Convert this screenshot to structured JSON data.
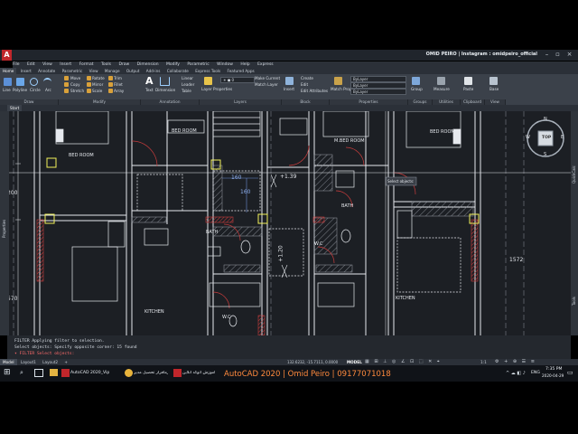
{
  "window": {
    "title": "OMID PEIRO | Instagram : omidpeiro_official",
    "app_logo": "A",
    "controls": [
      "minimize-icon",
      "restore-icon",
      "close-icon"
    ]
  },
  "menubar": [
    "File",
    "Edit",
    "View",
    "Insert",
    "Format",
    "Tools",
    "Draw",
    "Dimension",
    "Modify",
    "Parametric",
    "Window",
    "Help",
    "Express"
  ],
  "ribbon_tabs": [
    "Home",
    "Insert",
    "Annotate",
    "Parametric",
    "View",
    "Manage",
    "Output",
    "Add-ins",
    "Collaborate",
    "Express Tools",
    "Featured Apps"
  ],
  "ribbon": {
    "draw_tools": [
      "Line",
      "Polyline",
      "Circle",
      "Arc"
    ],
    "modify_tools": [
      "Move",
      "Rotate",
      "Trim",
      "Copy",
      "Mirror",
      "Fillet",
      "Stretch",
      "Scale",
      "Array"
    ],
    "annotation_tools": [
      "Text",
      "Dimension",
      "Linear",
      "Leader",
      "Table"
    ],
    "layer_tools": [
      "Layer Properties",
      "Make Current",
      "Match Layer"
    ],
    "block_tools": [
      "Insert",
      "Create",
      "Edit",
      "Edit Attributes"
    ],
    "properties_tools": [
      "Match Properties"
    ],
    "bylayer": [
      "ByLayer",
      "ByLayer",
      "ByLayer"
    ],
    "groups_label": "Group",
    "utilities_tools": [
      "Measure"
    ],
    "clipboard_tools": [
      "Paste"
    ],
    "view_tools": [
      "Base"
    ],
    "panels": [
      "Draw",
      "Modify",
      "Annotation",
      "Layers",
      "Block",
      "Properties",
      "Groups",
      "Utilities",
      "Clipboard",
      "View"
    ]
  },
  "file_tab": "Start",
  "drawing": {
    "room_labels": [
      "BED ROOM",
      "BED ROOM",
      "M.BED ROOM",
      "BED ROOM",
      "BATH",
      "BATH",
      "W.C",
      "KITCHEN",
      "KITCHEN",
      "W.C"
    ],
    "dimensions": [
      "160",
      "160",
      "+1.39",
      "+1.20",
      "1572",
      "200",
      "570"
    ],
    "tooltip": "Select objects:",
    "viewcube": {
      "top": "TOP",
      "n": "N",
      "s": "S",
      "e": "E",
      "w": "W"
    }
  },
  "side_labels": {
    "left": "Properties",
    "right_top": "QuickCalc",
    "right_bottom": "Tools"
  },
  "command_line": {
    "lines": [
      "FILTER Applying filter to selection.",
      "Select objects: Specify opposite corner: 15 found"
    ],
    "prompt_cmd": "FILTER",
    "prompt_text": "Select objects:"
  },
  "layout_tabs": [
    "Model",
    "Layout1",
    "Layout2",
    "+"
  ],
  "status": {
    "coords": "132.6232, -15.7111, 0.0000",
    "mode": "MODEL",
    "scale": "1:1"
  },
  "taskbar": {
    "apps": [
      "AutoCAD 2020_Vip",
      "نرمافزار تحصیل مدیر - FILTE...",
      "آموزش اتوکد آنلاین"
    ],
    "watermark": "AutoCAD 2020 | Omid Peiro | 09177071018",
    "lang": "ENG",
    "time": "7:35 PM",
    "date": "2020-04-29"
  },
  "colors": {
    "accent": "#c0262b",
    "watermark": "#ff8a3d",
    "grip": "#f2f25a",
    "wall_hatch": "#c63c3c"
  }
}
